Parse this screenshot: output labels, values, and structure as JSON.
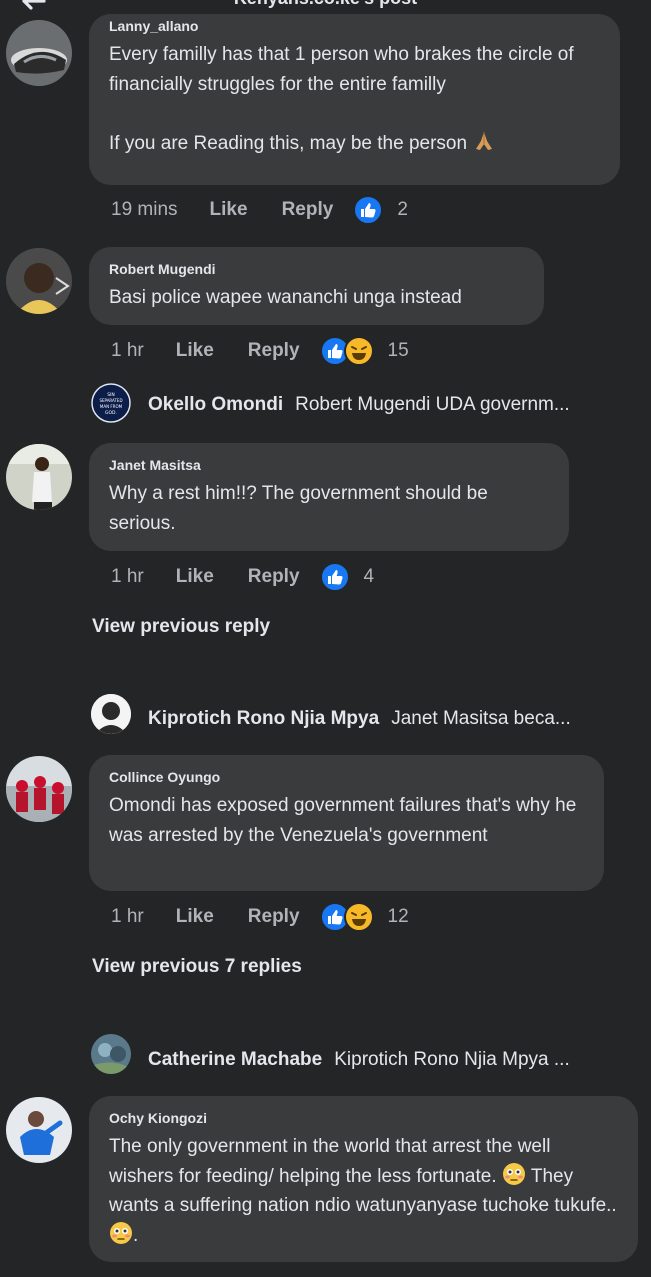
{
  "header": {
    "title": "Kenyans.co.ke's post"
  },
  "comments": [
    {
      "author": "Lanny_allano",
      "text": "Every familly has that 1 person who brakes the circle of financially struggles for the entire familly\n\nIf you are Reading this, may be the person",
      "time": "19 mins",
      "like_label": "Like",
      "reply_label": "Reply",
      "reaction_count": "2"
    },
    {
      "author": "Robert Mugendi",
      "text": "Basi police wapee wananchi unga instead",
      "time": "1 hr",
      "like_label": "Like",
      "reply_label": "Reply",
      "reaction_count": "15",
      "reply_preview": {
        "name": "Okello Omondi",
        "text": "Robert Mugendi UDA governm..."
      }
    },
    {
      "author": "Janet Masitsa",
      "text": "Why a rest him!!? The government should be serious.",
      "time": "1 hr",
      "like_label": "Like",
      "reply_label": "Reply",
      "reaction_count": "4",
      "view_previous": "View previous reply",
      "reply_preview": {
        "name": "Kiprotich Rono Njia Mpya",
        "text": "Janet Masitsa beca..."
      }
    },
    {
      "author": "Collince Oyungo",
      "text": "Omondi has exposed government failures that's why he was arrested by the Venezuela's government",
      "time": "1 hr",
      "like_label": "Like",
      "reply_label": "Reply",
      "reaction_count": "12",
      "view_previous": "View previous 7 replies",
      "reply_preview": {
        "name": "Catherine Machabe",
        "text": "Kiprotich Rono Njia Mpya ..."
      }
    },
    {
      "author": "Ochy Kiongozi",
      "text_part1": "The only government in the world that arrest the well wishers for feeding/ helping the less fortunate.",
      "text_part2": " They wants a suffering nation ndio watunyanyase tuchoke tukufe..",
      "text_part3": "."
    }
  ],
  "avatar_badge": {
    "line1": "SIN",
    "line2": "SEPARATED",
    "line3": "MAN FROM",
    "line4": "GOD."
  },
  "colors": {
    "background": "#242526",
    "bubble": "#3a3b3c",
    "text": "#e4e6eb",
    "muted": "#b0b3b8",
    "like_blue": "#1877f2",
    "haha_yellow": "#f7b928"
  },
  "icons": [
    "back-arrow-icon",
    "like-reaction-icon",
    "haha-reaction-icon",
    "praying-hands-emoji",
    "flushed-face-emoji"
  ]
}
